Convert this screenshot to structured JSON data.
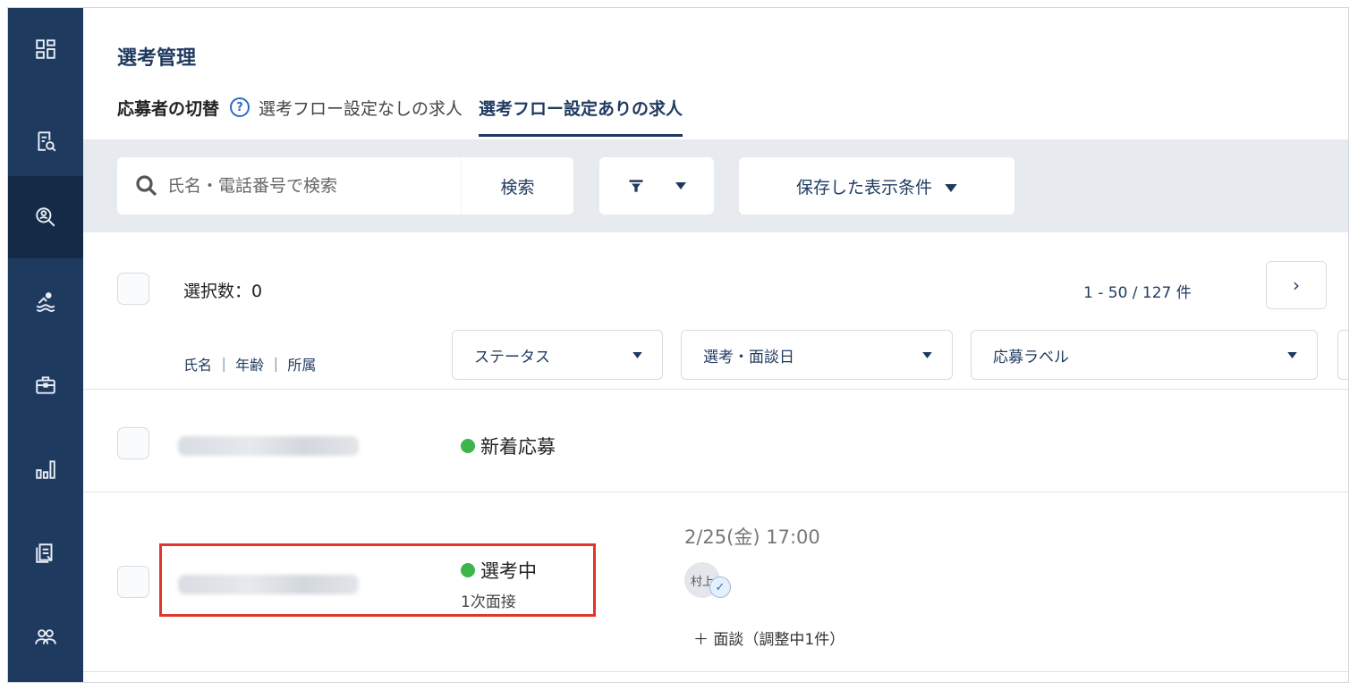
{
  "sidebar": {
    "items": [
      {
        "icon": "dashboard-icon",
        "active": false
      },
      {
        "icon": "document-search-icon",
        "active": false
      },
      {
        "icon": "person-search-icon",
        "active": true
      },
      {
        "icon": "swimmer-icon",
        "active": false
      },
      {
        "icon": "briefcase-icon",
        "active": false
      },
      {
        "icon": "bar-chart-icon",
        "active": false
      },
      {
        "icon": "clipboard-icon",
        "active": false
      },
      {
        "icon": "users-icon",
        "active": false
      }
    ]
  },
  "page": {
    "title": "選考管理",
    "switch_label": "応募者の切替",
    "help_glyph": "?",
    "tabs": [
      {
        "label": "選考フロー設定なしの求人",
        "active": false
      },
      {
        "label": "選考フロー設定ありの求人",
        "active": true
      }
    ]
  },
  "filter_bar": {
    "search_placeholder": "氏名・電話番号で検索",
    "search_button": "検索",
    "saved_conditions": "保存した表示条件"
  },
  "list": {
    "selected_count": "選択数：0",
    "pagination": "1 - 50 / 127 件",
    "next_glyph": "›",
    "column_name": "氏名 ｜ 年齢 ｜ 所属",
    "columns": [
      {
        "label": "ステータス"
      },
      {
        "label": "選考・面談日"
      },
      {
        "label": "応募ラベル"
      }
    ],
    "rows": [
      {
        "status": "新着応募",
        "status_color": "#3cb54a"
      },
      {
        "status": "選考中",
        "status_color": "#3cb54a",
        "substatus": "1次面接",
        "schedule": "2/25(金) 17:00",
        "interviewer": "村上",
        "add_meeting": "＋ 面談（調整中1件）"
      }
    ]
  },
  "colors": {
    "sidebar_bg": "#1f3a5f",
    "sidebar_active": "#152a46",
    "accent": "#1f3a5f",
    "highlight": "#e0362b"
  }
}
